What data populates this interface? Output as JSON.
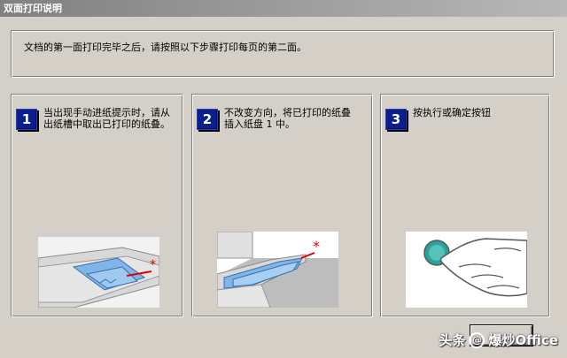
{
  "window": {
    "title": "双面打印说明"
  },
  "instruction": "文档的第一面打印完毕之后，请按照以下步骤打印每页的第二面。",
  "steps": [
    {
      "number": "1",
      "text": "当出现手动进纸提示时，请从出纸槽中取出已打印的纸叠。"
    },
    {
      "number": "2",
      "text": "不改变方向，将已打印的纸叠插入纸盘 1 中。"
    },
    {
      "number": "3",
      "text": "按执行或确定按钮"
    }
  ],
  "buttons": {
    "finish": ""
  },
  "watermark": {
    "text": "头条 @爆炒Office",
    "platform": "头条",
    "handle": "爆炒Office"
  },
  "colors": {
    "badge": "#0a1f8c",
    "accent_star": "#e00000",
    "paper": "#7fb5e8"
  }
}
